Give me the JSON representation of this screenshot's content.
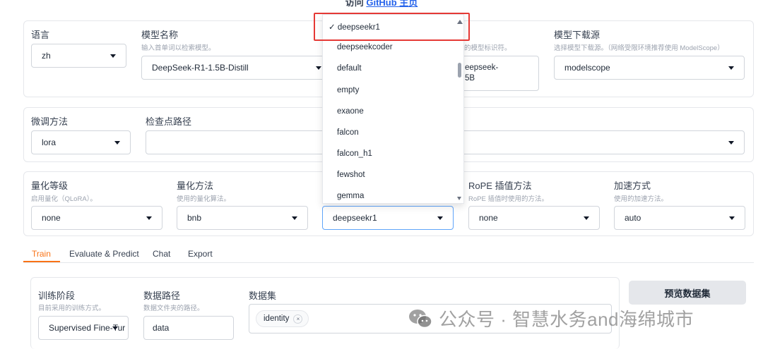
{
  "top_link": {
    "prefix": "访问",
    "link": "GitHub 主页"
  },
  "row1": {
    "language": {
      "label": "语言",
      "value": "zh"
    },
    "model_name": {
      "label": "模型名称",
      "hint": "输入首单词以检索模型。",
      "value": "DeepSeek-R1-1.5B-Distill"
    },
    "model_path": {
      "hint": "的模型标识符。",
      "value_line1": "eepseek-",
      "value_line2": "5B"
    },
    "model_source": {
      "label": "模型下载源",
      "hint": "选择模型下载源。（网络受限环境推荐使用 ModelScope）",
      "value": "modelscope"
    }
  },
  "row2": {
    "finetune": {
      "label": "微调方法",
      "value": "lora"
    },
    "checkpoint": {
      "label": "检查点路径",
      "value": ""
    }
  },
  "row3": {
    "quant_bit": {
      "label": "量化等级",
      "hint": "启用量化（QLoRA）。",
      "value": "none"
    },
    "quant_method": {
      "label": "量化方法",
      "hint": "使用的量化算法。",
      "value": "bnb"
    },
    "template": {
      "value": "deepseekr1"
    },
    "rope": {
      "label": "RoPE 插值方法",
      "hint": "RoPE 插值时使用的方法。",
      "value": "none"
    },
    "booster": {
      "label": "加速方式",
      "hint": "使用的加速方法。",
      "value": "auto"
    }
  },
  "dropdown": {
    "check_mark": "✓",
    "options": [
      "deepseekr1",
      "deepseekcoder",
      "default",
      "empty",
      "exaone",
      "falcon",
      "falcon_h1",
      "fewshot",
      "gemma"
    ]
  },
  "tabs": [
    "Train",
    "Evaluate & Predict",
    "Chat",
    "Export"
  ],
  "train": {
    "stage": {
      "label": "训练阶段",
      "hint": "目前采用的训练方式。",
      "value": "Supervised Fine-Tur"
    },
    "dataset_dir": {
      "label": "数据路径",
      "hint": "数据文件夹的路径。",
      "value": "data"
    },
    "dataset": {
      "label": "数据集",
      "chip": "identity",
      "chip_close": "×"
    },
    "preview_button": "预览数据集"
  },
  "watermark": "公众号 · 智慧水务and海绵城市",
  "colors": {
    "accent": "#f97316",
    "highlight": "#e53935",
    "link": "#2563eb"
  }
}
